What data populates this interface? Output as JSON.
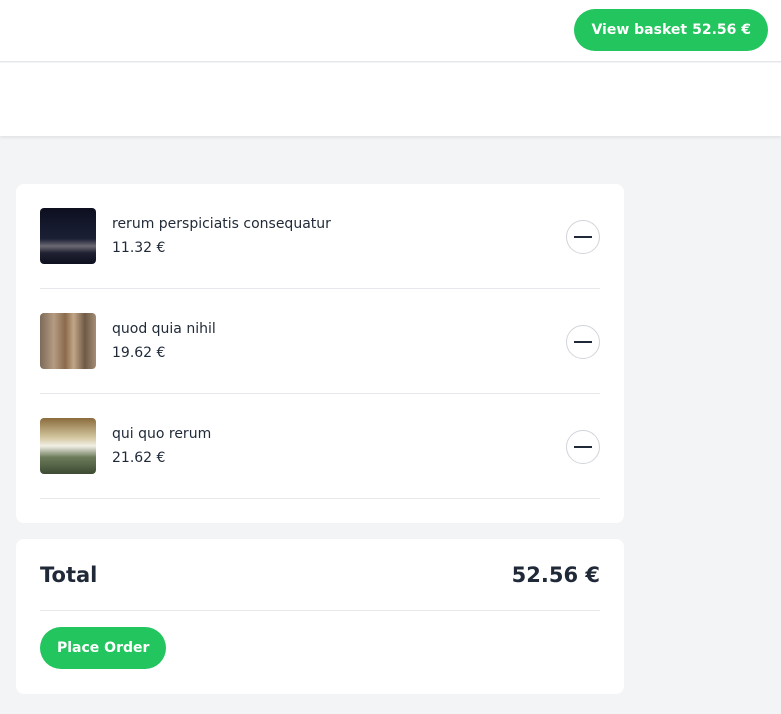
{
  "header": {
    "basket_label": "View basket",
    "basket_total": "52.56 €"
  },
  "basket": {
    "items": [
      {
        "name": "rerum perspiciatis consequatur",
        "price": "11.32 €",
        "remove_icon": "minus-icon"
      },
      {
        "name": "quod quia nihil",
        "price": "19.62 €",
        "remove_icon": "minus-icon"
      },
      {
        "name": "qui quo rerum",
        "price": "21.62 €",
        "remove_icon": "minus-icon"
      }
    ]
  },
  "summary": {
    "total_label": "Total",
    "total_value": "52.56 €",
    "place_order_label": "Place Order"
  },
  "colors": {
    "accent": "#22c55e",
    "background": "#f3f4f6",
    "card": "#ffffff",
    "text": "#1f2937"
  }
}
